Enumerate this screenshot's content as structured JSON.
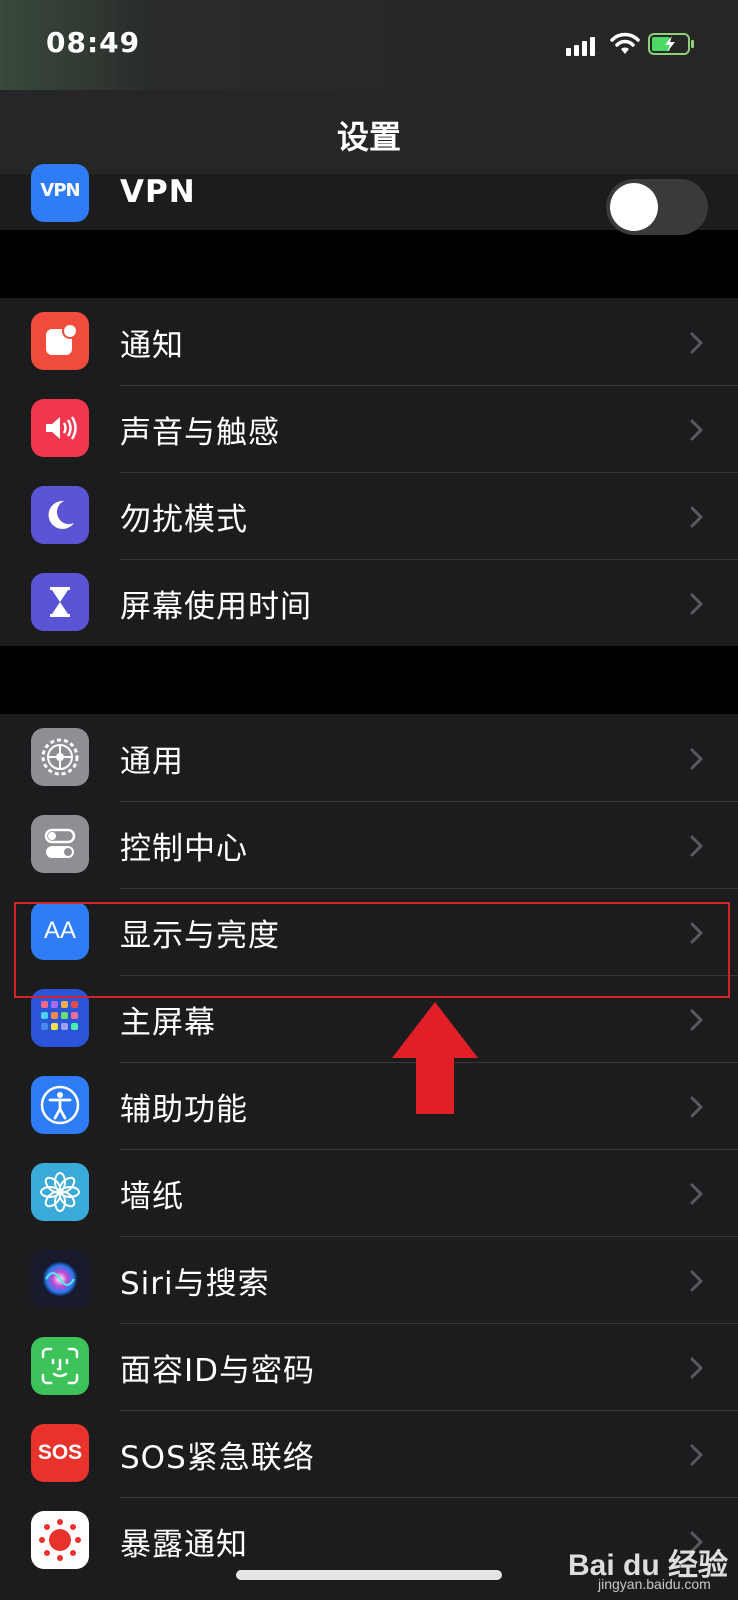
{
  "status_bar": {
    "time": "08:49"
  },
  "nav": {
    "title": "设置"
  },
  "vpn": {
    "icon_text": "VPN",
    "label": "VPN",
    "toggle_on": false
  },
  "group1": [
    {
      "label": "通知",
      "icon": "notifications-icon",
      "color": "#f04b3c"
    },
    {
      "label": "声音与触感",
      "icon": "sound-icon",
      "color": "#f0374e"
    },
    {
      "label": "勿扰模式",
      "icon": "moon-icon",
      "color": "#5b55d6"
    },
    {
      "label": "屏幕使用时间",
      "icon": "hourglass-icon",
      "color": "#5b55d6"
    }
  ],
  "group2": [
    {
      "label": "通用",
      "icon": "gear-icon",
      "color": "#8e8e93"
    },
    {
      "label": "控制中心",
      "icon": "toggles-icon",
      "color": "#8e8e93"
    },
    {
      "label": "显示与亮度",
      "icon": "aa-text-icon",
      "icon_text": "AA",
      "color": "#2f7df6"
    },
    {
      "label": "主屏幕",
      "icon": "home-screen-icon",
      "color": "#2b55d9"
    },
    {
      "label": "辅助功能",
      "icon": "accessibility-icon",
      "color": "#2f7df6"
    },
    {
      "label": "墙纸",
      "icon": "flower-icon",
      "color": "#3aaad8"
    },
    {
      "label": "Siri与搜索",
      "icon": "siri-icon",
      "color": "#1a1a2e"
    },
    {
      "label": "面容ID与密码",
      "icon": "face-id-icon",
      "color": "#3ec35a"
    },
    {
      "label": "SOS紧急联络",
      "icon": "sos-icon",
      "icon_text": "SOS",
      "color": "#e8322c"
    },
    {
      "label": "暴露通知",
      "icon": "exposure-icon",
      "color": "#ffffff"
    }
  ],
  "watermark": {
    "brand": "Bai du 经验",
    "url": "jingyan.baidu.com"
  },
  "colors": {
    "accent_red": "#d3242b",
    "background": "#000000",
    "cell": "#1c1c1e"
  }
}
